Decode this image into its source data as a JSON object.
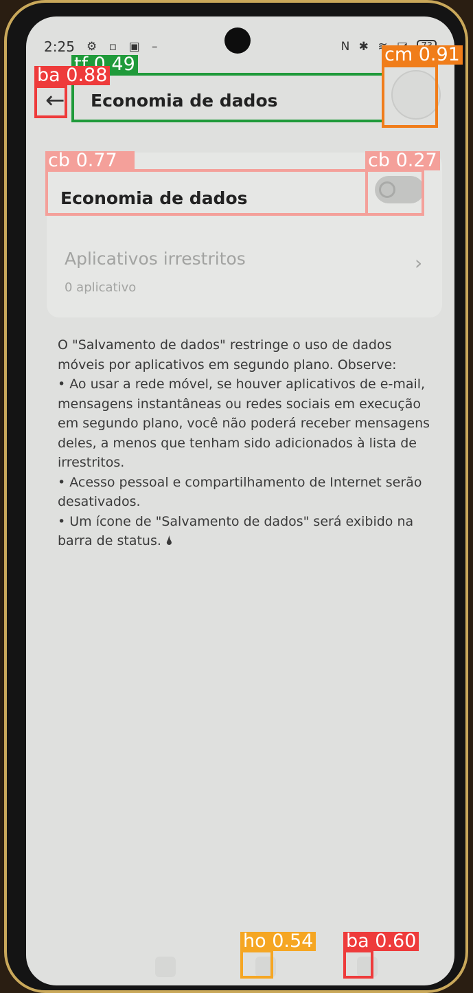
{
  "status_bar": {
    "time": "2:25",
    "left_icons": "⚙ ▫ ▣ –",
    "right_icons": "N ✱ ≋ ◪",
    "battery": "73"
  },
  "header": {
    "title": "Economia de dados"
  },
  "settings": {
    "data_saver_label": "Economia de dados",
    "data_saver_enabled": false,
    "unrestricted_label": "Aplicativos irrestritos",
    "unrestricted_count": "0 aplicativo"
  },
  "description": {
    "p1": "O \"Salvamento de dados\" restringe o uso de dados móveis por aplicativos em segundo plano. Observe:",
    "p2": "• Ao usar a rede móvel, se houver aplicativos de e-mail, mensagens instantâneas ou redes sociais em execução em segundo plano, você não poderá receber mensagens deles, a menos que tenham sido adicionados à lista de irrestritos.",
    "p3": "• Acesso pessoal e compartilhamento de Internet serão desativados.",
    "p4": "• Um ícone de \"Salvamento de dados\" será exibido na barra de status. 🌢"
  },
  "annotations": {
    "ba_top": "ba 0.88",
    "tf_top": "tf 0.49",
    "cm_top": "cm 0.91",
    "cb_left": "cb 0.77",
    "cb_right": "cb 0.27",
    "ho_bottom": "ho 0.54",
    "ba_bottom": "ba 0.60"
  },
  "colors": {
    "ba": "#ee3b3b",
    "tf": "#1f9a3a",
    "cm": "#f07d1a",
    "cb": "#f4a09a",
    "ho": "#f5a623"
  }
}
